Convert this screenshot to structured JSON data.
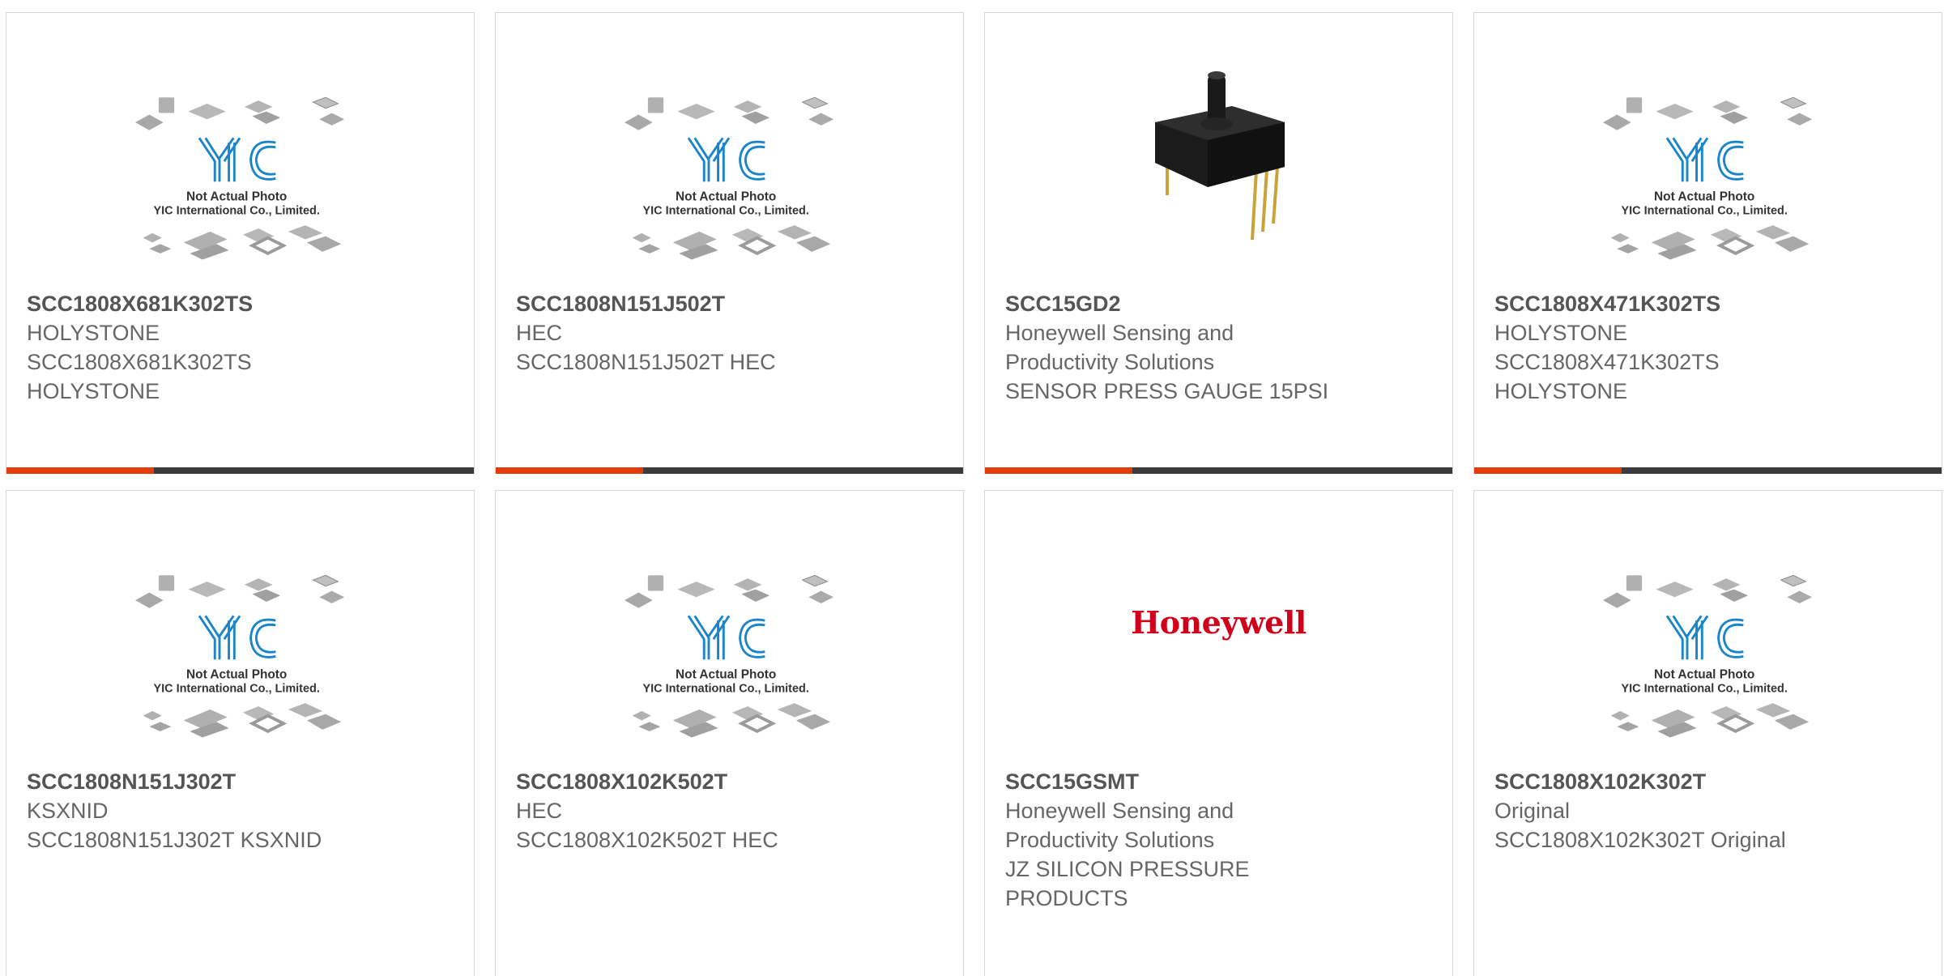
{
  "placeholder": {
    "brand": "YIC",
    "caption_line1": "Not Actual Photo",
    "caption_line2": "YIC International Co., Limited.",
    "brand_color": "#1a85c8"
  },
  "honeywell_logo_text": "Honeywell",
  "colors": {
    "accent": "#e43c0c",
    "bar": "#3b3b3b",
    "text": "#666666",
    "title": "#555555",
    "honeywell": "#d0021b"
  },
  "products": [
    {
      "part": "SCC1808X681K302TS",
      "lines": [
        "HOLYSTONE",
        "SCC1808X681K302TS",
        "HOLYSTONE"
      ],
      "image": "placeholder"
    },
    {
      "part": "SCC1808N151J502T",
      "lines": [
        "HEC",
        "SCC1808N151J502T HEC"
      ],
      "image": "placeholder"
    },
    {
      "part": "SCC15GD2",
      "lines": [
        "Honeywell Sensing and",
        "Productivity Solutions",
        "SENSOR PRESS GAUGE 15PSI"
      ],
      "image": "pressure-sensor-photo"
    },
    {
      "part": "SCC1808X471K302TS",
      "lines": [
        "HOLYSTONE",
        "SCC1808X471K302TS",
        "HOLYSTONE"
      ],
      "image": "placeholder"
    },
    {
      "part": "SCC1808N151J302T",
      "lines": [
        "KSXNID",
        "SCC1808N151J302T KSXNID"
      ],
      "image": "placeholder"
    },
    {
      "part": "SCC1808X102K502T",
      "lines": [
        "HEC",
        "SCC1808X102K502T HEC"
      ],
      "image": "placeholder"
    },
    {
      "part": "SCC15GSMT",
      "lines": [
        "Honeywell Sensing and",
        "Productivity Solutions",
        "JZ SILICON PRESSURE",
        "PRODUCTS"
      ],
      "image": "honeywell-logo"
    },
    {
      "part": "SCC1808X102K302T",
      "lines": [
        "Original",
        "SCC1808X102K302T Original"
      ],
      "image": "placeholder"
    }
  ]
}
